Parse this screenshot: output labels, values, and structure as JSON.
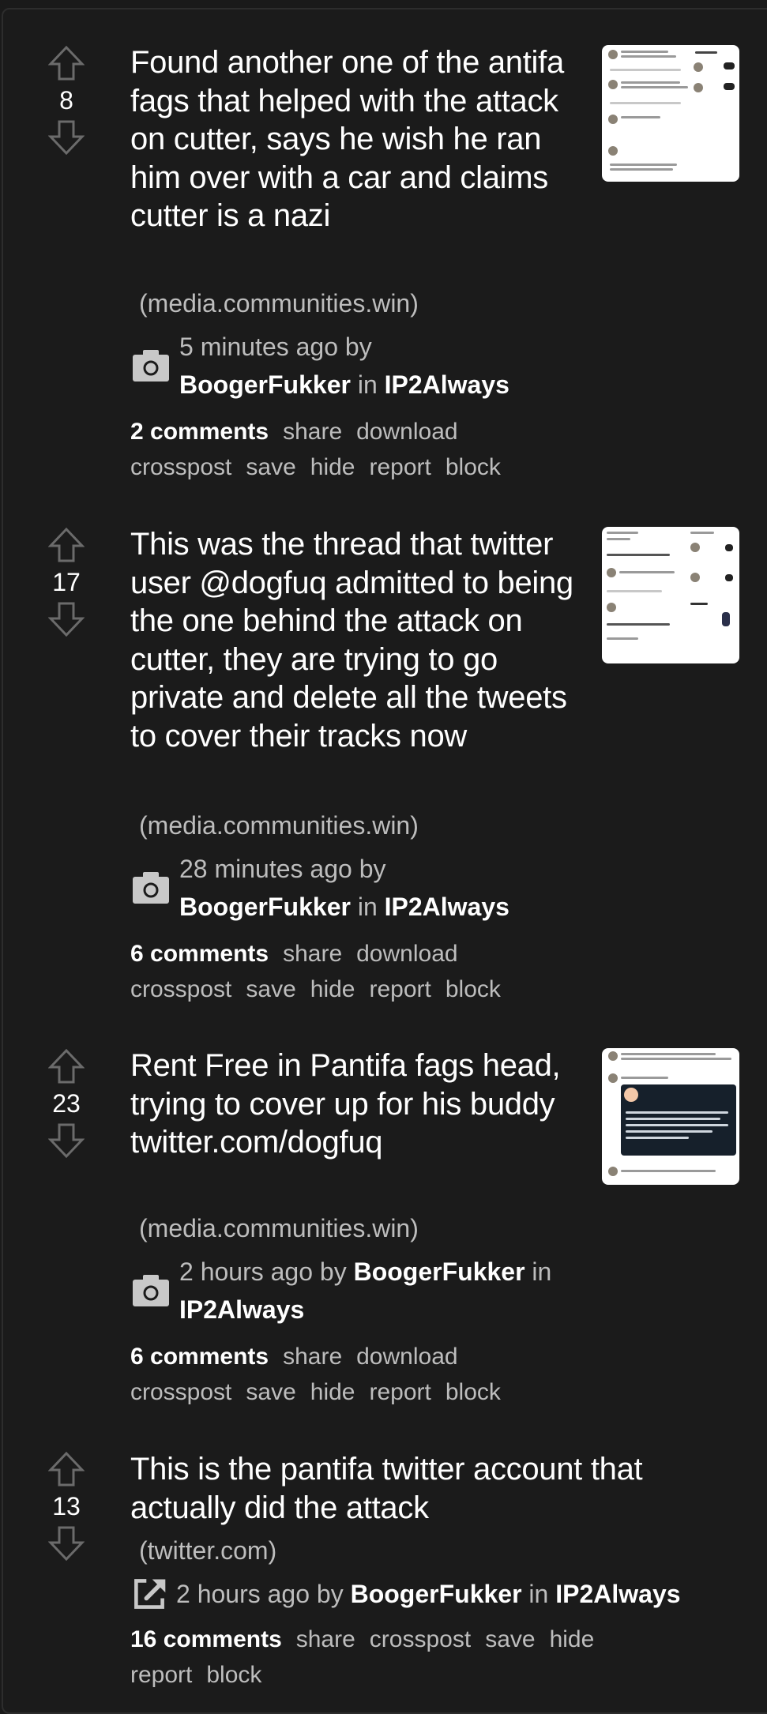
{
  "posts": [
    {
      "score": "8",
      "title": "Found another one of the antifa fags that helped with the attack on cutter, says he wish he ran him over with a car and claims cutter is a nazi",
      "domain": "(media.communities.win)",
      "type_icon": "camera-icon",
      "time": "5 minutes ago",
      "by": "by",
      "author": "BoogerFukker",
      "in": "in",
      "community": "IP2Always",
      "comments": "2 comments",
      "actions": [
        "share",
        "download",
        "crosspost",
        "save",
        "hide",
        "report",
        "block"
      ],
      "has_thumbnail": true
    },
    {
      "score": "17",
      "title": "This was the thread that twitter user @dogfuq admitted to being the one behind the attack on cutter, they are trying to go private and delete all the tweets to cover their tracks now",
      "domain": "(media.communities.win)",
      "type_icon": "camera-icon",
      "time": "28 minutes ago",
      "by": "by",
      "author": "BoogerFukker",
      "in": "in",
      "community": "IP2Always",
      "comments": "6 comments",
      "actions": [
        "share",
        "download",
        "crosspost",
        "save",
        "hide",
        "report",
        "block"
      ],
      "has_thumbnail": true
    },
    {
      "score": "23",
      "title": "Rent Free in Pantifa fags head, trying to cover up for his buddy twitter.com/dogfuq",
      "domain": "(media.communities.win)",
      "type_icon": "camera-icon",
      "time": "2 hours ago",
      "by": "by",
      "author": "BoogerFukker",
      "in": "in",
      "community": "IP2Always",
      "comments": "6 comments",
      "actions": [
        "share",
        "download",
        "crosspost",
        "save",
        "hide",
        "report",
        "block"
      ],
      "has_thumbnail": true
    },
    {
      "score": "13",
      "title": "This is the pantifa twitter account that actually did the attack",
      "domain": "(twitter.com)",
      "type_icon": "external-link-icon",
      "time": "2 hours ago",
      "by": "by",
      "author": "BoogerFukker",
      "in": "in",
      "community": "IP2Always",
      "comments": "16 comments",
      "actions": [
        "share",
        "crosspost",
        "save",
        "hide",
        "report",
        "block"
      ],
      "has_thumbnail": false
    }
  ],
  "colors": {
    "background": "#1b1b1b",
    "text_primary": "#ffffff",
    "text_secondary": "#bdbdbd",
    "vote_arrow": "#6b6b6b",
    "icon": "#c8c8c8"
  }
}
